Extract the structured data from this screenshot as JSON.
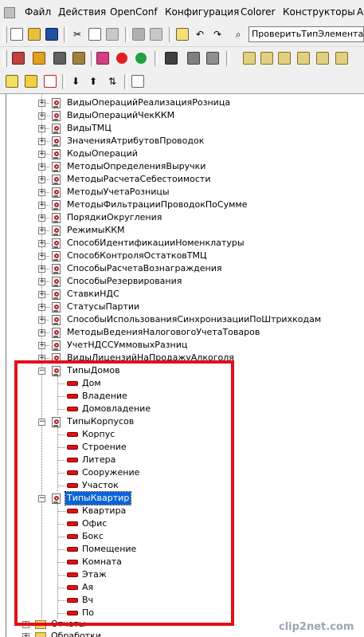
{
  "menubar": {
    "items": [
      "Файл",
      "Действия",
      "OpenConf",
      "Конфигурация",
      "Colorer",
      "Конструкторы",
      "А"
    ]
  },
  "toolbar": {
    "combo_value": "ПроверитьТипЭлемента("
  },
  "tree": {
    "items": [
      {
        "label": "ВидыОперацийРеализацияРозница"
      },
      {
        "label": "ВидыОперацийЧекККМ"
      },
      {
        "label": "ВидыТМЦ"
      },
      {
        "label": "ЗначенияАтрибутовПроводок"
      },
      {
        "label": "КодыОпераций"
      },
      {
        "label": "МетодыОпределенияВыручки"
      },
      {
        "label": "МетодыРасчетаСебестоимости"
      },
      {
        "label": "МетодыУчетаРозницы"
      },
      {
        "label": "МетодыФильтрацииПроводокПоСумме"
      },
      {
        "label": "ПорядкиОкругления"
      },
      {
        "label": "РежимыККМ"
      },
      {
        "label": "СпособИдентификацииНоменклатуры"
      },
      {
        "label": "СпособКонтроляОстатковТМЦ"
      },
      {
        "label": "СпособыРасчетаВознаграждения"
      },
      {
        "label": "СпособыРезервирования"
      },
      {
        "label": "СтавкиНДС"
      },
      {
        "label": "СтатусыПартии"
      },
      {
        "label": "СпособыИспользованияСинхронизацииПоШтрихкодам"
      },
      {
        "label": "МетодыВеденияНалоговогоУчетаТоваров"
      },
      {
        "label": "УчетНДССУммовыхРазниц"
      },
      {
        "label": "ВидыЛицензийНаПродажуАлкоголя"
      }
    ],
    "groups": [
      {
        "label": "ТипыДомов",
        "values": [
          "Дом",
          "Владение",
          "Домовладение"
        ]
      },
      {
        "label": "ТипыКорпусов",
        "values": [
          "Корпус",
          "Строение",
          "Литера",
          "Сооружение",
          "Участок"
        ]
      },
      {
        "label": "ТипыКвартир",
        "values": [
          "Квартира",
          "Офис",
          "Бокс",
          "Помещение",
          "Комната",
          "Этаж",
          "Ая",
          "Вч",
          "По"
        ]
      }
    ],
    "bottom": [
      "Отчеты",
      "Обработки"
    ]
  },
  "watermark": "clip2net.com",
  "colors": {
    "highlight_box": "#e0101c",
    "selection": "#0a64d8"
  }
}
